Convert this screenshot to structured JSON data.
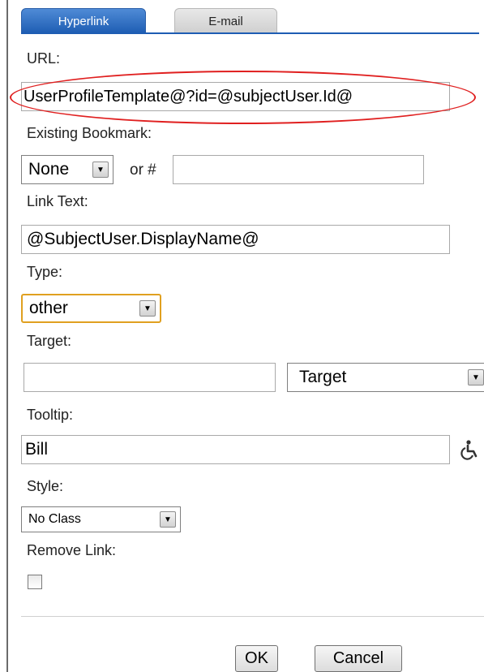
{
  "tabs": [
    {
      "label": "Hyperlink"
    },
    {
      "label": "E-mail"
    }
  ],
  "url": {
    "label": "URL:",
    "value": "UserProfileTemplate@?id=@subjectUser.Id@"
  },
  "bookmark": {
    "label": "Existing Bookmark:",
    "selected": "None",
    "or_label": "or #",
    "anchor_value": ""
  },
  "link_text": {
    "label": "Link Text:",
    "value": "@SubjectUser.DisplayName@"
  },
  "type": {
    "label": "Type:",
    "selected": "other"
  },
  "target": {
    "label": "Target:",
    "value": "",
    "selected": "Target"
  },
  "tooltip": {
    "label": "Tooltip:",
    "value": "Bill",
    "icon": "accessibility-icon"
  },
  "style": {
    "label": "Style:",
    "selected": "No Class"
  },
  "remove_link": {
    "label": "Remove Link:",
    "checked": false
  },
  "buttons": {
    "ok": "OK",
    "cancel": "Cancel"
  },
  "colors": {
    "tab_active": "#1e5db3",
    "highlight_ellipse": "#e02020",
    "type_focus_border": "#e0a020"
  }
}
